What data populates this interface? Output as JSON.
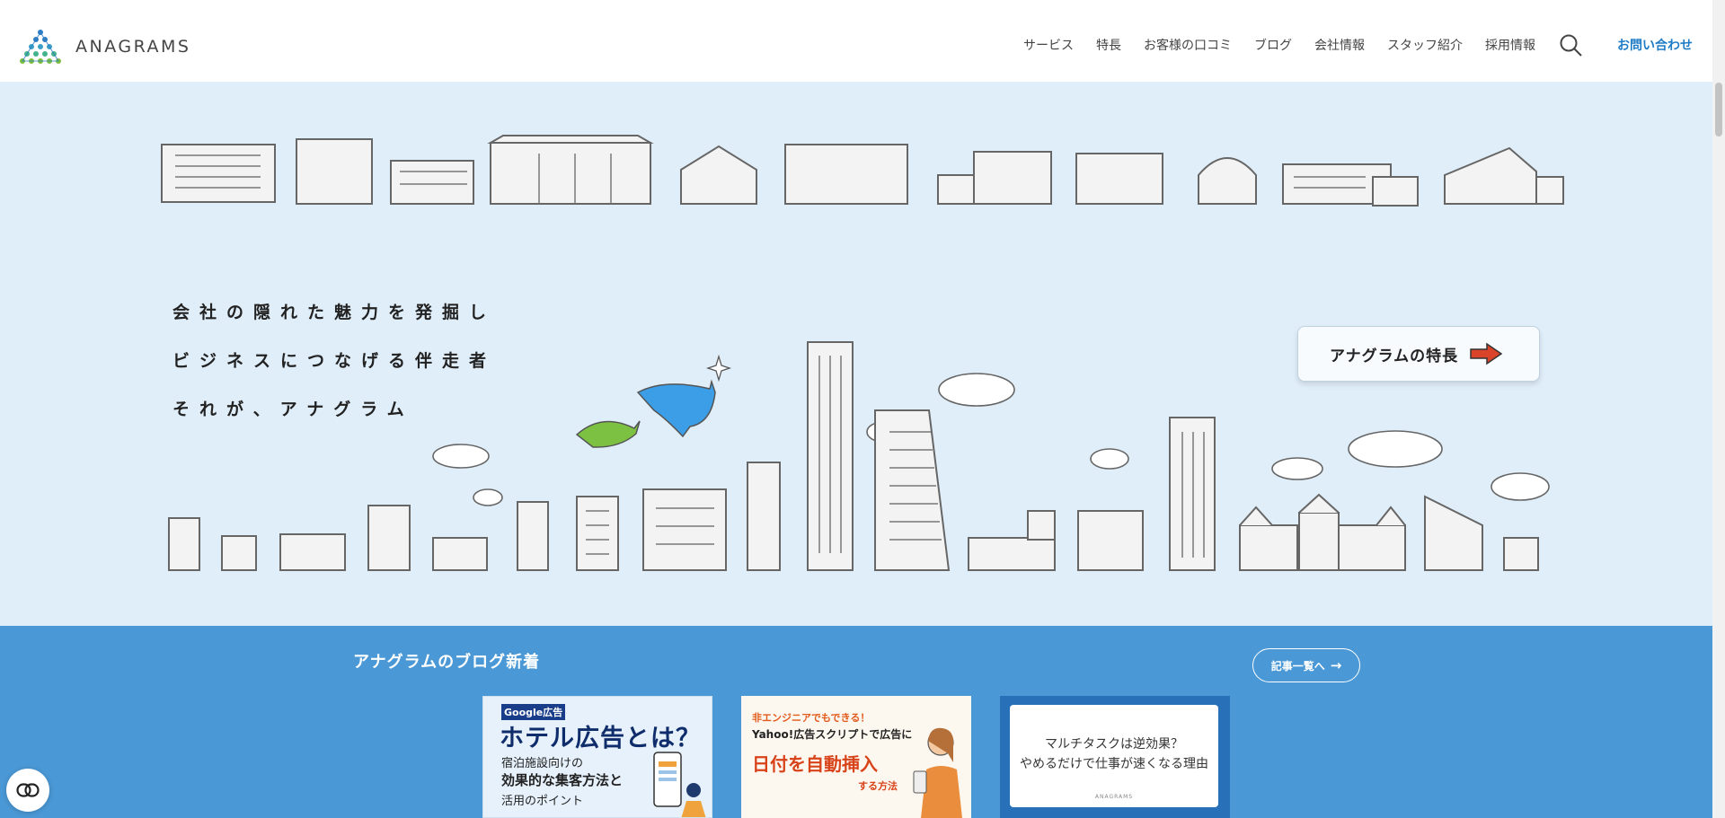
{
  "header": {
    "logo_text": "ANAGRAMS",
    "nav": [
      "サービス",
      "特長",
      "お客様の口コミ",
      "ブログ",
      "会社情報",
      "スタッフ紹介",
      "採用情報"
    ],
    "contact_label": "お問い合わせ"
  },
  "hero": {
    "tagline": [
      "会社の隠れた魅力を発掘し",
      "ビジネスにつなげる伴走者",
      "それが、アナグラム"
    ],
    "feature_button": "アナグラムの特長"
  },
  "blog": {
    "title": "アナグラムのブログ新着",
    "more_label": "記事一覧へ",
    "cards": [
      {
        "label": "Google広告",
        "title": "ホテル広告とは？",
        "line1": "宿泊施設向けの",
        "line2": "効果的な集客方法と",
        "line3": "活用のポイント"
      },
      {
        "top": "非エンジニアでもできる！",
        "middle": "Yahoo!広告スクリプトで広告に",
        "big": "日付を自動挿入",
        "small": "する方法"
      },
      {
        "line1": "マルチタスクは逆効果？",
        "line2": "やめるだけで仕事が速くなる理由",
        "logo": "ANAGRAMS"
      }
    ]
  },
  "colors": {
    "accent": "#1e7bc6",
    "hero_bg": "#e0eef9",
    "blog_bg": "#4a98d6"
  },
  "icons": [
    "anagrams-logo",
    "search-icon",
    "arrow-right-icon",
    "privacy-icon"
  ]
}
